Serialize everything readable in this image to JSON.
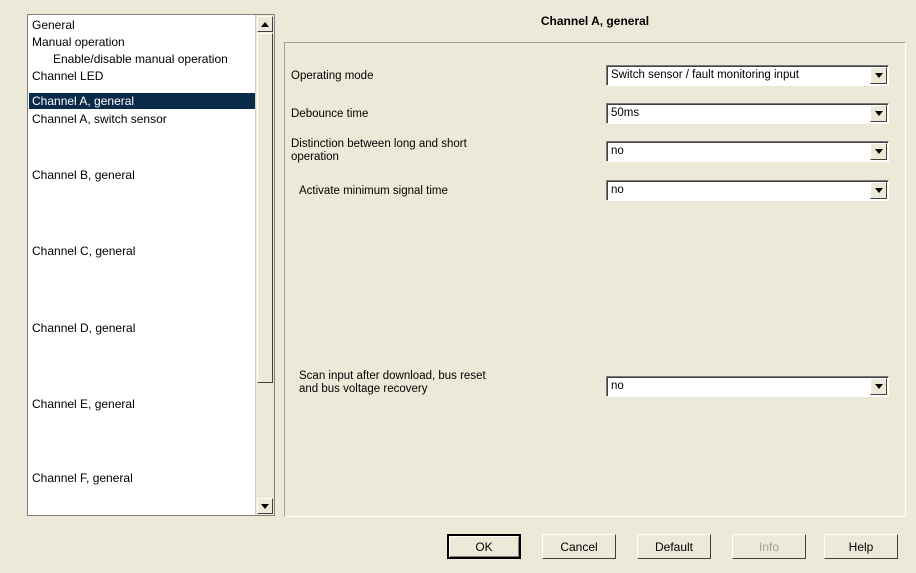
{
  "tree": {
    "items": [
      {
        "label": "General",
        "selected": false
      },
      {
        "label": "Manual operation",
        "selected": false
      },
      {
        "label": "Enable/disable manual operation",
        "selected": false
      },
      {
        "label": "Channel LED",
        "selected": false
      },
      {
        "label": "Channel A, general",
        "selected": true
      },
      {
        "label": "Channel A, switch sensor",
        "selected": false
      },
      {
        "label": "Channel B, general",
        "selected": false
      },
      {
        "label": "Channel C, general",
        "selected": false
      },
      {
        "label": "Channel D, general",
        "selected": false
      },
      {
        "label": "Channel E, general",
        "selected": false
      },
      {
        "label": "Channel F, general",
        "selected": false
      }
    ]
  },
  "panel": {
    "title": "Channel A, general",
    "params": [
      {
        "label": "Operating mode",
        "value": "Switch sensor / fault monitoring input"
      },
      {
        "label": "Debounce time",
        "value": "50ms"
      },
      {
        "label_line1": "Distinction between long and short",
        "label_line2": "operation",
        "value": "no"
      },
      {
        "label": "Activate minimum signal time",
        "value": "no"
      },
      {
        "label_line1": "Scan input after download, bus reset",
        "label_line2": "and bus voltage recovery",
        "value": "no"
      }
    ]
  },
  "buttons": {
    "ok": "OK",
    "cancel": "Cancel",
    "default": "Default",
    "info": "Info",
    "help": "Help"
  },
  "icons": {
    "scroll_up": "arrow-up-icon",
    "scroll_down": "arrow-down-icon",
    "dropdown": "chevron-down-icon"
  },
  "colors": {
    "selection_bg": "#0a2a4a",
    "window_bg": "#ece9d8"
  }
}
